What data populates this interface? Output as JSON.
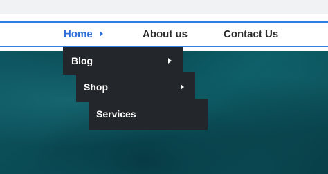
{
  "nav": {
    "items": [
      {
        "label": "Home",
        "active": true
      },
      {
        "label": "About us"
      },
      {
        "label": "Contact Us"
      }
    ]
  },
  "dropdown": {
    "items": [
      {
        "label": "Blog",
        "has_submenu": true
      },
      {
        "label": "Shop",
        "has_submenu": true
      },
      {
        "label": "Services",
        "has_submenu": false
      }
    ]
  },
  "colors": {
    "accent": "#2f7fe0",
    "active_text": "#2f6fd6",
    "menu_bg": "#23262b",
    "hero_bg": "#0b5560"
  },
  "icons": {
    "submenu": "caret-right-icon"
  }
}
